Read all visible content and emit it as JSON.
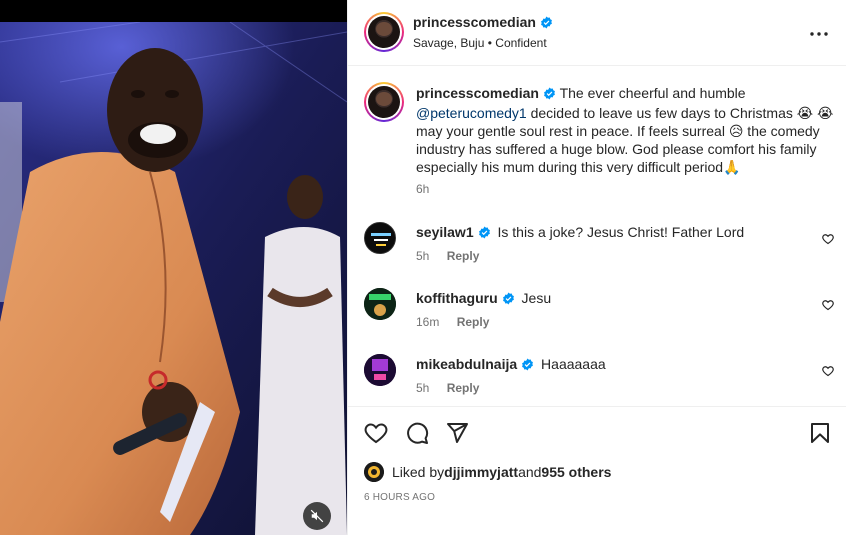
{
  "post": {
    "username": "princesscomedian",
    "music": "Savage, Buju",
    "separator": "•",
    "music_track": "Confident"
  },
  "caption": {
    "username": "princesscomedian",
    "text_part1": "The ever cheerful and humble ",
    "mention": "@peterucomedy1",
    "text_part2": " decided to leave us few days to Christmas 😭 😭 may your gentle soul rest in peace. If feels surreal 😥 the comedy industry has suffered a huge blow. God please comfort his family especially his mum during this very difficult period🙏",
    "time": "6h"
  },
  "comments": [
    {
      "username": "seyilaw1",
      "text": "Is this a joke? Jesus Christ! Father Lord",
      "time": "5h",
      "reply": "Reply"
    },
    {
      "username": "koffithaguru",
      "text": "Jesu",
      "time": "16m",
      "reply": "Reply"
    },
    {
      "username": "mikeabdulnaija",
      "text": "Haaaaaaa",
      "time": "5h",
      "reply": "Reply"
    }
  ],
  "likes": {
    "prefix": "Liked by ",
    "user": "djjimmyjatt",
    "and": " and ",
    "others": "955 others"
  },
  "date": "6 HOURS AGO",
  "icons": {
    "header_more": "more-options-icon",
    "like": "heart-icon",
    "comment": "comment-icon",
    "share": "send-icon",
    "save": "bookmark-icon",
    "mute": "muted-speaker-icon"
  },
  "colors": {
    "verified": "#0095f6",
    "mention": "#00376b",
    "secondary_text": "#737373"
  }
}
